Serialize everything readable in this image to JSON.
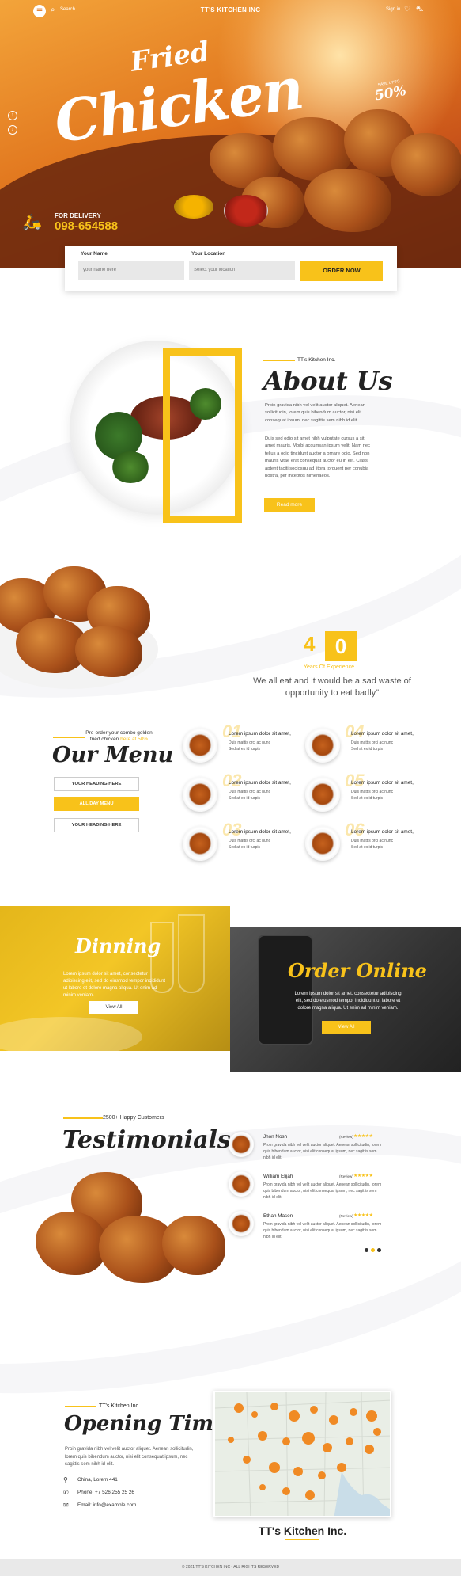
{
  "header": {
    "search_label": "Search",
    "brand": "TT'S KITCHEN INC",
    "signin": "Sign in"
  },
  "hero": {
    "title_top": "Fried",
    "title_main": "Chicken",
    "badge_small": "SAVE UPTO",
    "badge_value": "50%",
    "delivery_label": "FOR DELIVERY",
    "phone": "098-654588"
  },
  "order_form": {
    "name_label": "Your Name",
    "name_placeholder": "your name here",
    "location_label": "Your Location",
    "location_placeholder": "Select your location",
    "button": "ORDER NOW"
  },
  "about": {
    "small": "TT's Kitchen Inc.",
    "title": "About Us",
    "p1": "Proin gravida nibh vel velit auctor aliquet. Aenean sollicitudin, lorem quis bibendum auctor, nisi elit consequat ipsum, nec sagittis sem nibh id elit.",
    "p2": "Duis sed odio sit amet nibh vulputate cursus a sit amet mauris. Morbi accumsan ipsum velit. Nam nec tellus a odio tincidunt auctor a ornare odio. Sed non mauris vitae erat consequat auctor eu in elit. Class aptent taciti sociosqu ad litora torquent per conubia nostra, per inceptos himenaeos.",
    "button": "Read more"
  },
  "experience": {
    "digit1": "4",
    "digit2": "0",
    "label": "Years Of Experience",
    "quote": "We all eat and it would be a sad waste of opportunity to eat badly\""
  },
  "menu": {
    "pre": "Pre-order your combo golden fried chicken",
    "pre_link": "here at 50%",
    "title": "Our Menu",
    "buttons": [
      "YOUR HEADING HERE",
      "ALL DAY MENU",
      "YOUR HEADING HERE"
    ],
    "items": [
      {
        "num": "01",
        "title": "Lorem ipsum dolor sit amet,",
        "d1": "Duis mattis orci ac nunc",
        "d2": "Sed at ex id turpis"
      },
      {
        "num": "02",
        "title": "Lorem ipsum dolor sit amet,",
        "d1": "Duis mattis orci ac nunc",
        "d2": "Sed at ex id turpis"
      },
      {
        "num": "03",
        "title": "Lorem ipsum dolor sit amet,",
        "d1": "Duis mattis orci ac nunc",
        "d2": "Sed at ex id turpis"
      },
      {
        "num": "04",
        "title": "Lorem ipsum dolor sit amet,",
        "d1": "Duis mattis orci ac nunc",
        "d2": "Sed at ex id turpis"
      },
      {
        "num": "05",
        "title": "Lorem ipsum dolor sit amet,",
        "d1": "Duis mattis orci ac nunc",
        "d2": "Sed at ex id turpis"
      },
      {
        "num": "06",
        "title": "Lorem ipsum dolor sit amet,",
        "d1": "Duis mattis orci ac nunc",
        "d2": "Sed at ex id turpis"
      }
    ]
  },
  "dinning": {
    "title": "Dinning",
    "text": "Lorem ipsum dolor sit amet, consectetur adipiscing elit, sed do eiusmod tempor incididunt ut labore et dolore magna aliqua. Ut enim ad minim veniam.",
    "button": "View All"
  },
  "order_online": {
    "title": "Order Online",
    "text": "Lorem ipsum dolor sit amet, consectetur adipiscing elit, sed do eiusmod tempor incididunt ut labore et dolore magna aliqua. Ut enim ad minim veniam.",
    "button": "View All"
  },
  "testimonials": {
    "pre": "2500+ Happy Customers",
    "title": "Testimonials",
    "items": [
      {
        "name": "Jhon Nosh",
        "review": "(Review)",
        "stars": "★★★★★",
        "text": "Proin gravida nibh vel velit auctor aliquet. Aenean sollicitudin, lorem quis bibendum auctor, nisi elit consequat ipsum, nec sagittis sem nibh id elit."
      },
      {
        "name": "William Elijah",
        "review": "(Review)",
        "stars": "★★★★★",
        "text": "Proin gravida nibh vel velit auctor aliquet. Aenean sollicitudin, lorem quis bibendum auctor, nisi elit consequat ipsum, nec sagittis sem nibh id elit."
      },
      {
        "name": "Ethan Mason",
        "review": "(Review)",
        "stars": "★★★★★",
        "text": "Proin gravida nibh vel velit auctor aliquet. Aenean sollicitudin, lorem quis bibendum auctor, nisi elit consequat ipsum, nec sagittis sem nibh id elit."
      }
    ]
  },
  "opening": {
    "pre": "TT's Kitchen Inc.",
    "title": "Opening Time",
    "text": "Proin gravida nibh vel velit auctor aliquet. Aenean sollicitudin, lorem quis bibendum auctor, nisi elit consequat ipsum, nec sagittis sem nibh id elit.",
    "address": "China, Lorem 441",
    "phone": "Phone: +7 526 255 25 26",
    "email": "Email: info@example.com"
  },
  "map": {
    "brand": "TT's Kitchen Inc."
  },
  "footer": {
    "text": "© 2021 TT'S KITCHEN INC - ALL RIGHTS RESERVED"
  },
  "colors": {
    "accent": "#f8c21a",
    "hero_orange": "#e1761e",
    "dark": "#222222"
  }
}
